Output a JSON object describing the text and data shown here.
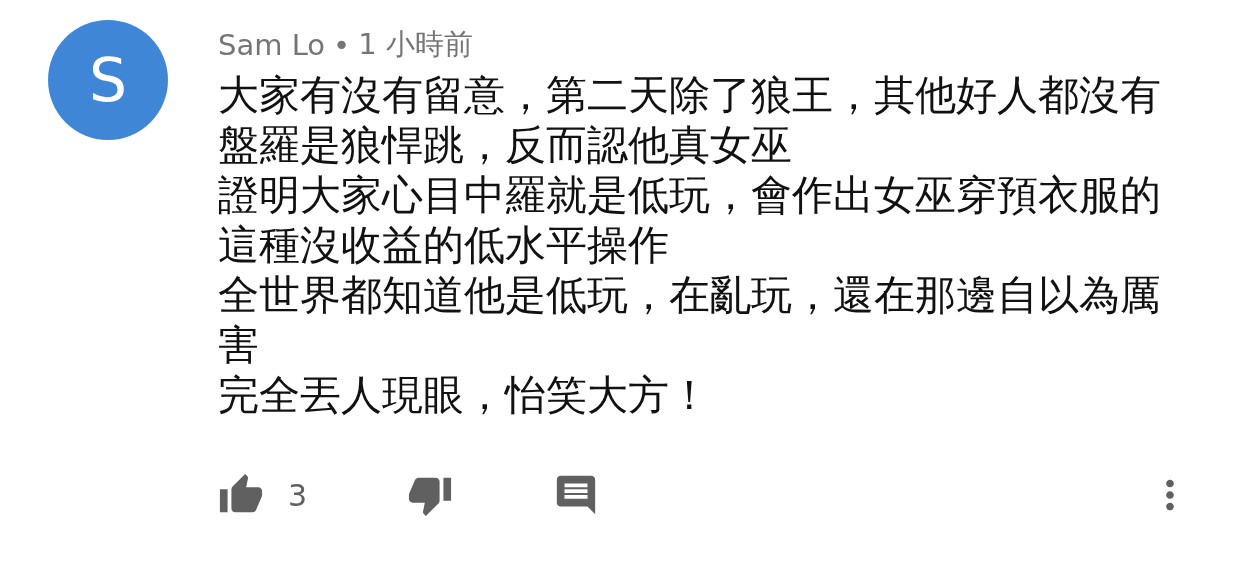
{
  "comment": {
    "avatar_letter": "S",
    "author": "Sam Lo",
    "separator": "•",
    "time": "1 小時前",
    "paragraphs": [
      "大家有沒有留意，第二天除了狼王，其他好人都沒有盤羅是狼悍跳，反而認他真女巫",
      "證明大家心目中羅就是低玩，會作出女巫穿預衣服的這種沒收益的低水平操作",
      "全世界都知道他是低玩，在亂玩，還在那邊自以為厲害",
      "完全丟人現眼，怡笑大方！"
    ],
    "like_count": "3"
  }
}
